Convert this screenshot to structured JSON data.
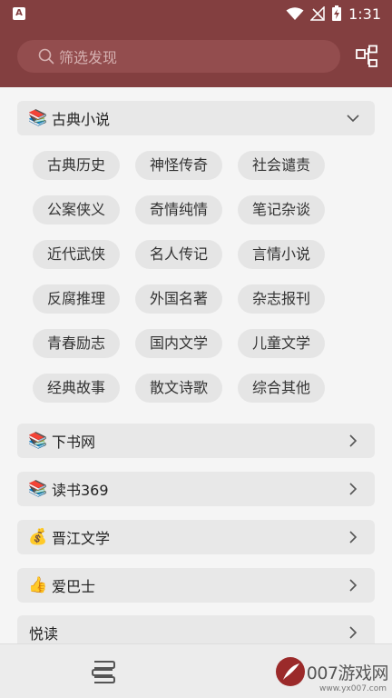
{
  "status": {
    "time": "1:31",
    "app_icon_letter": "A",
    "icons": [
      "wifi-icon",
      "no-signal-icon",
      "battery-charging-icon"
    ]
  },
  "search": {
    "placeholder": "筛选发现",
    "icon": "search-icon"
  },
  "header": {
    "right_icon": "layout-grid-icon",
    "bg_color": "#833f40"
  },
  "expanded_category": {
    "emoji": "📚",
    "label": "古典小说",
    "arrow": "chevron-down-icon",
    "chips": [
      "古典历史",
      "神怪传奇",
      "社会谴责",
      "公案侠义",
      "奇情纯情",
      "笔记杂谈",
      "近代武侠",
      "名人传记",
      "言情小说",
      "反腐推理",
      "外国名著",
      "杂志报刊",
      "青春励志",
      "国内文学",
      "儿童文学",
      "经典故事",
      "散文诗歌",
      "综合其他"
    ]
  },
  "sources": [
    {
      "emoji": "📚",
      "label": "下书网"
    },
    {
      "emoji": "📚",
      "label": "读书369"
    },
    {
      "emoji": "💰",
      "label": "晋江文学"
    },
    {
      "emoji": "👍",
      "label": "爱巴士"
    },
    {
      "emoji": "",
      "label": "悦读"
    }
  ],
  "bottom": {
    "icon": "bookshelf-icon",
    "watermark_text": "007游戏网",
    "watermark_url": "www.yx007.com"
  }
}
